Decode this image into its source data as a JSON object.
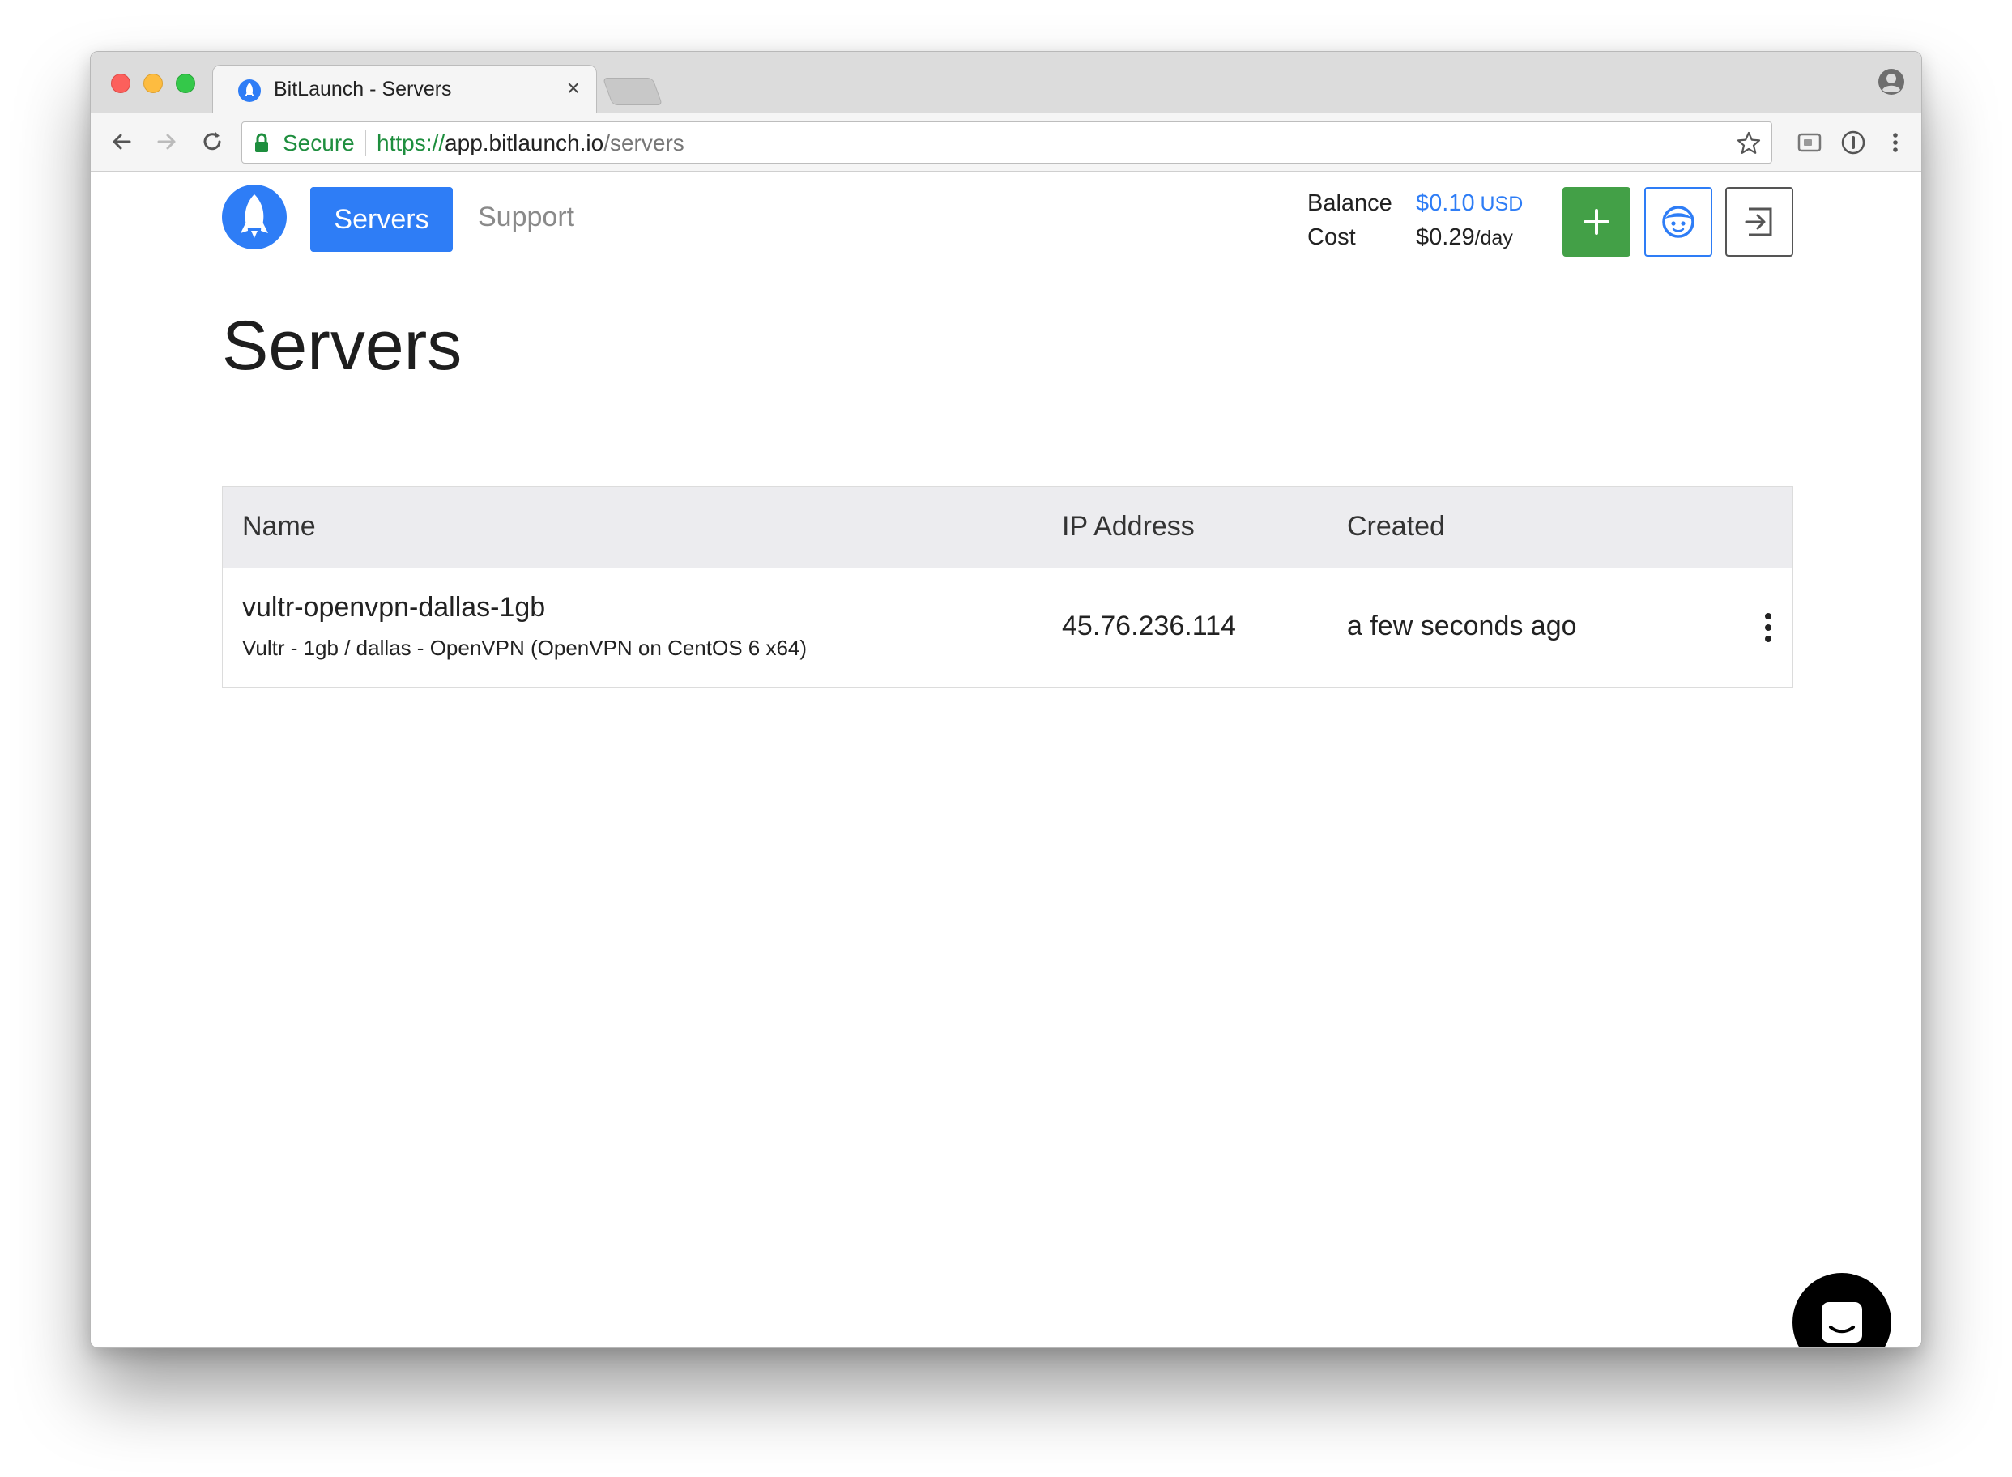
{
  "browser": {
    "tab_title": "BitLaunch - Servers",
    "tab_close": "×",
    "secure_label": "Secure",
    "url_scheme": "https://",
    "url_host": "app.bitlaunch.io",
    "url_path": "/servers"
  },
  "nav": {
    "servers_label": "Servers",
    "support_label": "Support"
  },
  "account": {
    "balance_label": "Balance",
    "balance_value": "$0.10",
    "balance_unit": " USD",
    "cost_label": "Cost",
    "cost_value": "$0.29",
    "cost_unit": "/day"
  },
  "page": {
    "title": "Servers"
  },
  "table": {
    "headers": [
      "Name",
      "IP Address",
      "Created"
    ],
    "rows": [
      {
        "name": "vultr-openvpn-dallas-1gb",
        "description": "Vultr - 1gb / dallas - OpenVPN (OpenVPN on CentOS 6 x64)",
        "ip": "45.76.236.114",
        "created": "a few seconds ago"
      }
    ]
  },
  "colors": {
    "primary": "#2e7df6",
    "success": "#43a047",
    "secure_green": "#1e8e3e"
  },
  "icons": [
    "rocket-icon",
    "plus-icon",
    "face-icon",
    "logout-icon",
    "more-vertical-icon",
    "chat-icon"
  ]
}
